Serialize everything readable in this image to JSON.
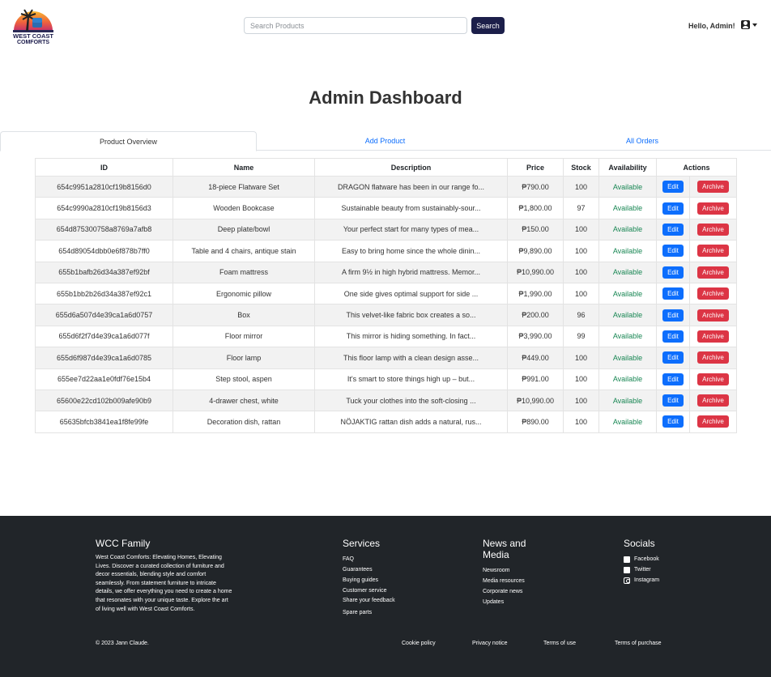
{
  "navbar": {
    "logo_text": "WEST COAST COMFORTS",
    "search_placeholder": "Search Products",
    "search_button": "Search",
    "greeting": "Hello, Admin!",
    "user_icon": "user-square-icon"
  },
  "page_title": "Admin Dashboard",
  "tabs": [
    {
      "label": "Product Overview",
      "active": true
    },
    {
      "label": "Add Product",
      "active": false
    },
    {
      "label": "All Orders",
      "active": false
    }
  ],
  "table": {
    "headers": [
      "ID",
      "Name",
      "Description",
      "Price",
      "Stock",
      "Availability",
      "Actions"
    ],
    "edit_label": "Edit",
    "archive_label": "Archive",
    "rows": [
      {
        "id": "654c9951a2810cf19b8156d0",
        "name": "18-piece Flatware Set",
        "description": "DRAGON flatware has been in our range fo...",
        "price": "₱790.00",
        "stock": "100",
        "availability": "Available"
      },
      {
        "id": "654c9990a2810cf19b8156d3",
        "name": "Wooden Bookcase",
        "description": "Sustainable beauty from sustainably-sour...",
        "price": "₱1,800.00",
        "stock": "97",
        "availability": "Available"
      },
      {
        "id": "654d875300758a8769a7afb8",
        "name": "Deep plate/bowl",
        "description": "Your perfect start for many types of mea...",
        "price": "₱150.00",
        "stock": "100",
        "availability": "Available"
      },
      {
        "id": "654d89054dbb0e6f878b7ff0",
        "name": "Table and 4 chairs, antique stain",
        "description": "Easy to bring home since the whole dinin...",
        "price": "₱9,890.00",
        "stock": "100",
        "availability": "Available"
      },
      {
        "id": "655b1bafb26d34a387ef92bf",
        "name": "Foam mattress",
        "description": "A firm 9½ in high hybrid mattress. Memor...",
        "price": "₱10,990.00",
        "stock": "100",
        "availability": "Available"
      },
      {
        "id": "655b1bb2b26d34a387ef92c1",
        "name": "Ergonomic pillow",
        "description": "One side gives optimal support for side ...",
        "price": "₱1,990.00",
        "stock": "100",
        "availability": "Available"
      },
      {
        "id": "655d6a507d4e39ca1a6d0757",
        "name": "Box",
        "description": "This velvet-like fabric box creates a so...",
        "price": "₱200.00",
        "stock": "96",
        "availability": "Available"
      },
      {
        "id": "655d6f2f7d4e39ca1a6d077f",
        "name": "Floor mirror",
        "description": "This mirror is hiding something. In fact...",
        "price": "₱3,990.00",
        "stock": "99",
        "availability": "Available"
      },
      {
        "id": "655d6f987d4e39ca1a6d0785",
        "name": "Floor lamp",
        "description": "This floor lamp with a clean design asse...",
        "price": "₱449.00",
        "stock": "100",
        "availability": "Available"
      },
      {
        "id": "655ee7d22aa1e0fdf76e15b4",
        "name": "Step stool, aspen",
        "description": "It's smart to store things high up – but...",
        "price": "₱991.00",
        "stock": "100",
        "availability": "Available"
      },
      {
        "id": "65600e22cd102b009afe90b9",
        "name": "4-drawer chest, white",
        "description": "Tuck your clothes into the soft-closing ...",
        "price": "₱10,990.00",
        "stock": "100",
        "availability": "Available"
      },
      {
        "id": "65635bfcb3841ea1f8fe99fe",
        "name": "Decoration dish, rattan",
        "description": "NÖJAKTIG rattan dish adds a natural, rus...",
        "price": "₱890.00",
        "stock": "100",
        "availability": "Available"
      }
    ]
  },
  "footer": {
    "family": {
      "title": "WCC Family",
      "text": "West Coast Comforts: Elevating Homes, Elevating Lives. Discover a curated collection of furniture and decor essentials, blending style and comfort seamlessly. From statement furniture to intricate details, we offer everything you need to create a home that resonates with your unique taste. Explore the art of living well with West Coast Comforts."
    },
    "services": {
      "title": "Services",
      "items": [
        "FAQ",
        "Guarantees",
        "Buying guides",
        "Customer service",
        "Share your feedback",
        "Spare parts"
      ]
    },
    "news": {
      "title": "News and Media",
      "items": [
        "Newsroom",
        "Media resources",
        "Corporate news",
        "Updates"
      ]
    },
    "socials": {
      "title": "Socials",
      "items": [
        {
          "label": "Facebook",
          "icon": "facebook-icon"
        },
        {
          "label": "Twitter",
          "icon": "twitter-icon"
        },
        {
          "label": "Instagram",
          "icon": "instagram-icon"
        }
      ]
    },
    "copyright": "© 2023 Jann Claude.",
    "links": [
      "Cookie policy",
      "Privacy notice",
      "Terms of use",
      "Terms of purchase"
    ]
  }
}
